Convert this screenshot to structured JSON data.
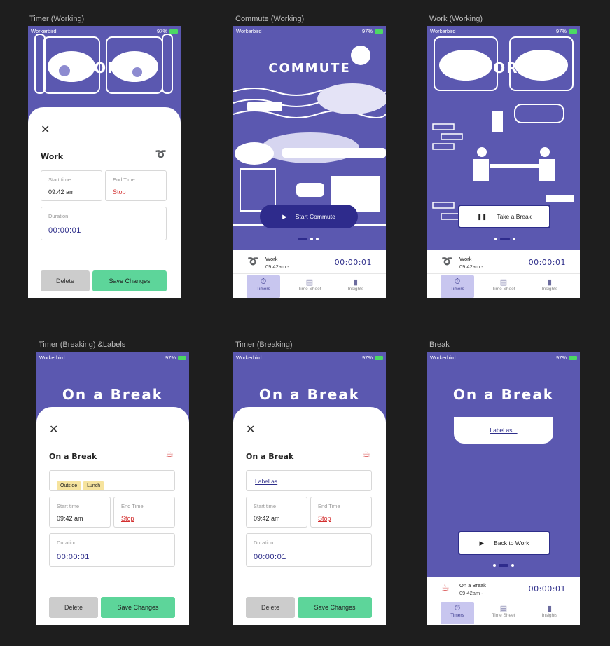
{
  "frames": {
    "f1": {
      "label": "Timer (Working)"
    },
    "f2": {
      "label": "Commute (Working)"
    },
    "f3": {
      "label": "Work (Working)"
    },
    "f4": {
      "label": "Timer (Breaking) &Labels"
    },
    "f5": {
      "label": "Timer (Breaking)"
    },
    "f6": {
      "label": "Break"
    }
  },
  "status": {
    "carrier": "Workerbird",
    "battery": "97%"
  },
  "timer_working": {
    "hero": "WORK",
    "title": "Work",
    "start_label": "Start time",
    "start_value": "09:42 am",
    "end_label": "End Time",
    "end_value": "Stop",
    "duration_label": "Duration",
    "duration_value": "00:00:01",
    "delete": "Delete",
    "save": "Save Changes"
  },
  "commute": {
    "hero": "COMMUTE",
    "start_btn": "Start Commute",
    "mini_name": "Work",
    "mini_time": "09:42am -",
    "mini_dur": "00:00:01"
  },
  "work": {
    "hero": "WORK",
    "break_btn": "Take a Break",
    "mini_name": "Work",
    "mini_time": "09:42am -",
    "mini_dur": "00:00:01"
  },
  "tabs": {
    "timers": "Timers",
    "timesheet": "Time Sheet",
    "insights": "Insights"
  },
  "breaking_labels": {
    "hero": "On a Break",
    "title": "On a Break",
    "tags": [
      "Outside",
      "Lunch"
    ],
    "start_label": "Start time",
    "start_value": "09:42 am",
    "end_label": "End Time",
    "end_value": "Stop",
    "duration_label": "Duration",
    "duration_value": "00:00:01",
    "delete": "Delete",
    "save": "Save Changes"
  },
  "breaking": {
    "hero": "On a Break",
    "title": "On a Break",
    "label_as": "Label as",
    "start_label": "Start time",
    "start_value": "09:42 am",
    "end_label": "End Time",
    "end_value": "Stop",
    "duration_label": "Duration",
    "duration_value": "00:00:01",
    "delete": "Delete",
    "save": "Save Changes"
  },
  "break_screen": {
    "hero": "On a Break",
    "label_as": "Label as...",
    "back_btn": "Back to Work",
    "mini_name": "On a Break",
    "mini_time": "09:42am -",
    "mini_dur": "00:00:01"
  }
}
